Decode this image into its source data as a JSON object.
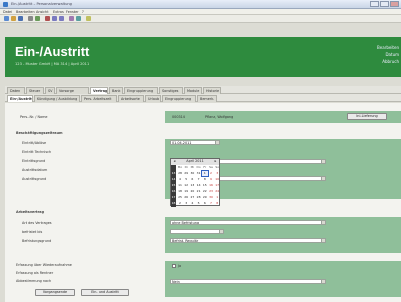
{
  "window": {
    "title": "Ein-/Austritt – Personalverwaltung"
  },
  "menu": [
    "Datei",
    "Bearbeiten",
    "Ansicht",
    "Extras",
    "Fenster",
    "?"
  ],
  "header": {
    "title": "Ein-/Austritt",
    "subtitle": "123 - Muster GmbH | MA 314 | April 2011",
    "right_lines": [
      "Bearbeiten",
      "Datum",
      "Abbruch"
    ]
  },
  "tabs_row1": [
    "Daten",
    "Steuer",
    "SV",
    "Vorsorge",
    "Vertrag",
    "Bank",
    "Eingruppierung",
    "Sonstiges",
    "Module",
    "Historie"
  ],
  "tabs_row1_active": 4,
  "tabs_row2": [
    "Ein-/Austritt",
    "Kündigung / Ausbildung",
    "Pers. Arbeitszeit",
    "Arbeitsorte",
    "Urlaub",
    "Eingruppierung",
    "Bemerk."
  ],
  "tabs_row2_active": 0,
  "person": {
    "label": "Pers.-Nr. / Name",
    "number": "000314",
    "name": "Pflanz, Wolfgang",
    "button": "Ini-Lieferung"
  },
  "employment": {
    "section": "Beschäftigungszeitraum",
    "labels": [
      "Eintritt/Ablöse",
      "Eintritt Technisch",
      "Eintrittsgrund",
      "Austrittsdatum",
      "Austrittsgrund"
    ],
    "entry_date": "01.04.2011"
  },
  "calendar": {
    "header": "April 2011",
    "weekdays": [
      "Mo",
      "Di",
      "Mi",
      "Do",
      "Fr",
      "Sa",
      "So"
    ],
    "weeks": [
      "13",
      "14",
      "15",
      "16",
      "17",
      "18"
    ],
    "days": [
      [
        "28",
        "29",
        "30",
        "31",
        "1",
        "2",
        "3"
      ],
      [
        "4",
        "5",
        "6",
        "7",
        "8",
        "9",
        "10"
      ],
      [
        "11",
        "12",
        "13",
        "14",
        "15",
        "16",
        "17"
      ],
      [
        "18",
        "19",
        "20",
        "21",
        "22",
        "23",
        "24"
      ],
      [
        "25",
        "26",
        "27",
        "28",
        "29",
        "30",
        "1"
      ],
      [
        "2",
        "3",
        "4",
        "5",
        "6",
        "7",
        "8"
      ]
    ],
    "selected_day": "1"
  },
  "work": {
    "section": "Arbeitsvertrag",
    "labels": [
      "Art des Vertrages",
      "befristet bis",
      "Befristungsgrund"
    ],
    "contract_type": "ohne Befristung",
    "limit_reason": "Befrist. Regulär"
  },
  "bottom": {
    "labels": [
      "Erfassung über Wiederaufnahme",
      "Erfassung als Rentner",
      "Abbestimmung nach"
    ],
    "check_label": "Ja",
    "value": "Nein",
    "buttons": [
      "Vorgangsende",
      "Ein- und Austritt"
    ]
  },
  "colors": {
    "header_green": "#2e8b3e",
    "panel_green": "#8fbf9a"
  }
}
